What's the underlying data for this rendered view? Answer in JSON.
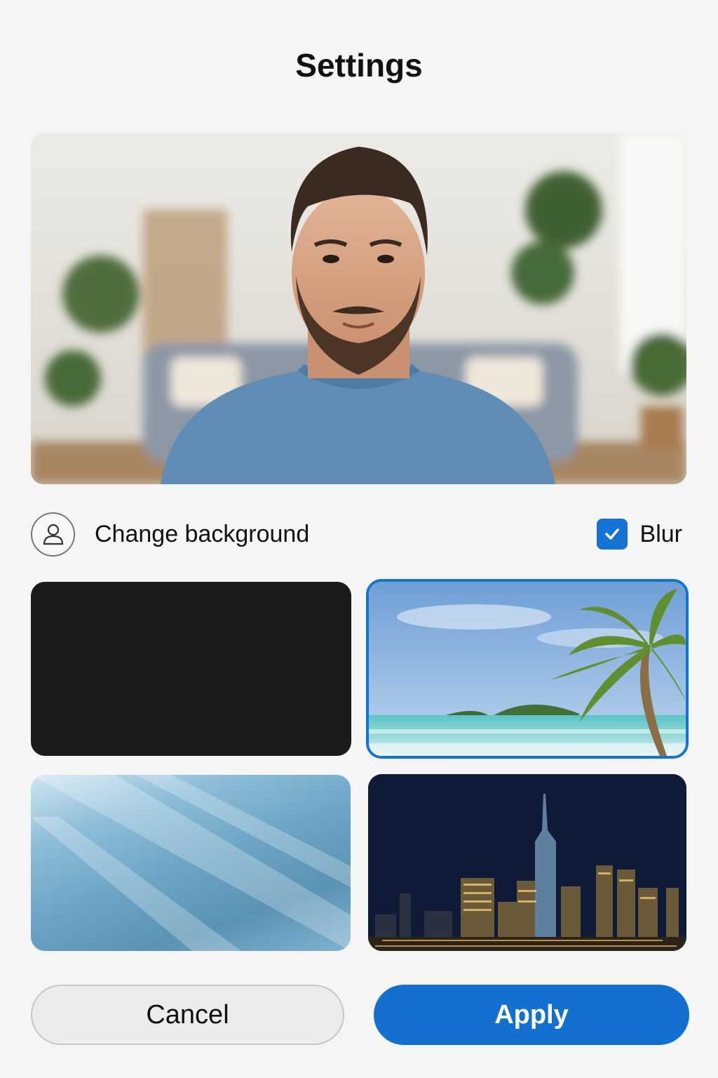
{
  "header": {
    "title": "Settings"
  },
  "background_section": {
    "label": "Change background",
    "icon": "person-icon",
    "blur": {
      "label": "Blur",
      "checked": true,
      "icon": "checkmark-icon"
    }
  },
  "backgrounds": [
    {
      "id": "black",
      "selected": false
    },
    {
      "id": "beach",
      "selected": true
    },
    {
      "id": "blue-gradient",
      "selected": false
    },
    {
      "id": "city-night",
      "selected": false
    }
  ],
  "actions": {
    "cancel_label": "Cancel",
    "apply_label": "Apply"
  },
  "colors": {
    "accent": "#1470d0",
    "page_background": "#f5f5f5"
  }
}
